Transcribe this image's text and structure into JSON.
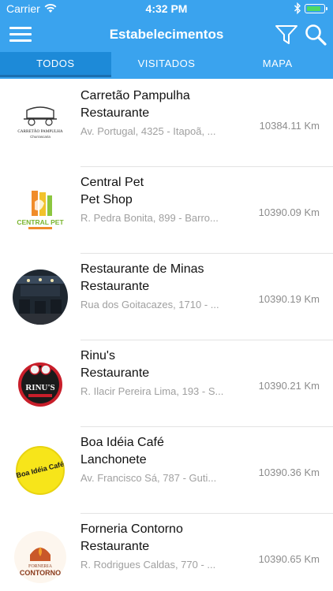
{
  "status_bar": {
    "carrier": "Carrier",
    "time": "4:32 PM",
    "battery_level": 0.85
  },
  "nav": {
    "title": "Estabelecimentos",
    "icons": [
      "menu-icon",
      "filter-icon",
      "search-icon"
    ]
  },
  "tabs": [
    {
      "label": "TODOS",
      "active": true
    },
    {
      "label": "VISITADOS",
      "active": false
    },
    {
      "label": "MAPA",
      "active": false
    }
  ],
  "colors": {
    "header": "#3aa3ee",
    "active_tab": "#1d8ad8",
    "address": "#a0a0a0",
    "distance": "#8c8c8c"
  },
  "places": [
    {
      "name": "Carretão Pampulha",
      "category": "Restaurante",
      "address": "Av. Portugal, 4325 - Itapoã, ...",
      "distance": "10384.11 Km",
      "logo_text_1": "CARRETÃO PAMPULHA",
      "logo_text_2": "Churrascaria"
    },
    {
      "name": "Central Pet",
      "category": "Pet Shop",
      "address": "R. Pedra Bonita, 899 - Barro...",
      "distance": "10390.09 Km",
      "logo_text_1": "CENTRAL PET"
    },
    {
      "name": "Restaurante de Minas",
      "category": "Restaurante",
      "address": "Rua dos Goitacazes, 1710 - ...",
      "distance": "10390.19 Km"
    },
    {
      "name": "Rinu's",
      "category": "Restaurante",
      "address": "R. Ilacir Pereira Lima, 193 - S...",
      "distance": "10390.21 Km",
      "logo_text_1": "RINU'S"
    },
    {
      "name": "Boa Idéia Café",
      "category": "Lanchonete",
      "address": "Av. Francisco Sá, 787 - Guti...",
      "distance": "10390.36 Km",
      "logo_text_1": "Boa Idéia Café"
    },
    {
      "name": "Forneria Contorno",
      "category": "Restaurante",
      "address": "R. Rodrigues Caldas, 770 - ...",
      "distance": "10390.65 Km",
      "logo_text_1": "FORNERIA",
      "logo_text_2": "CONTORNO"
    }
  ]
}
